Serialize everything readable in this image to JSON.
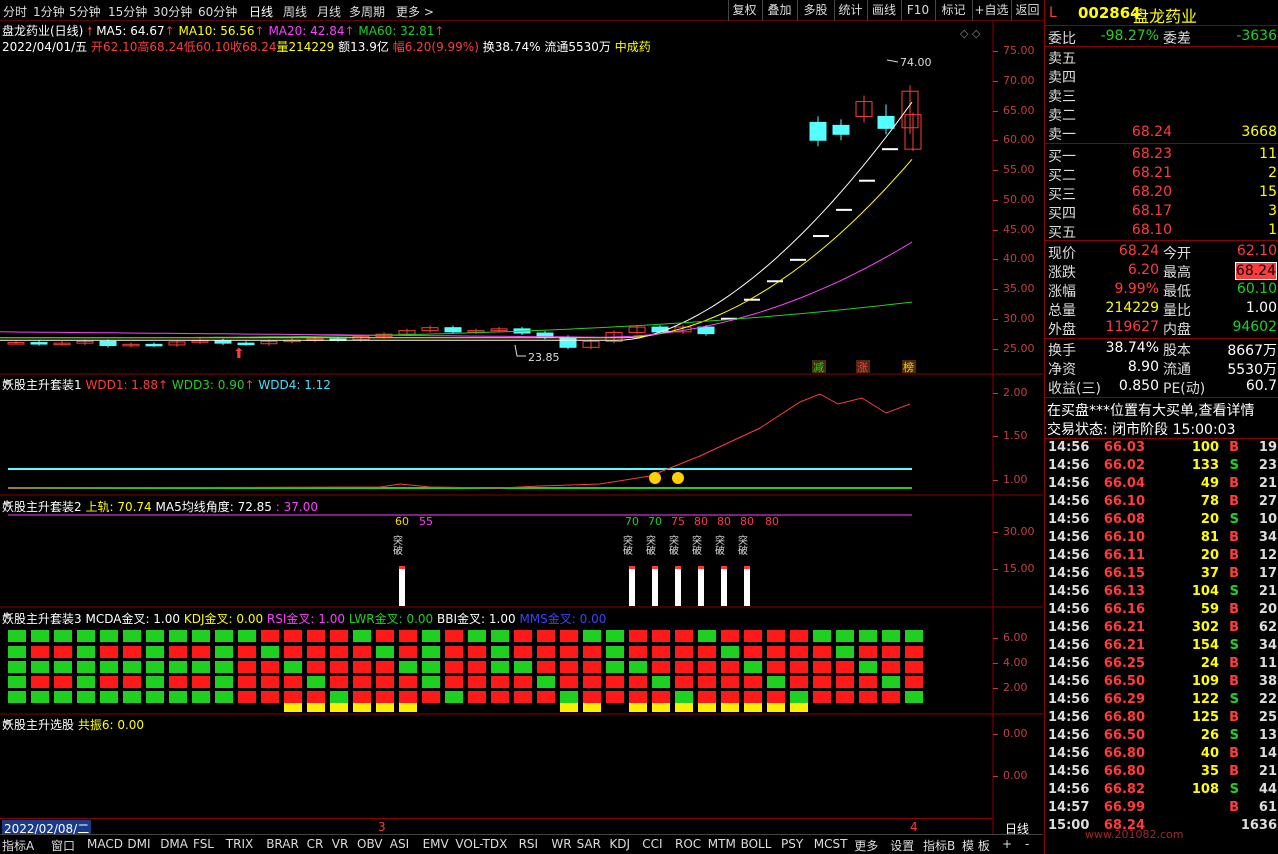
{
  "toolbar": {
    "periods": [
      "分时",
      "1分钟",
      "5分钟",
      "15分钟",
      "30分钟",
      "60分钟",
      "日线",
      "周线",
      "月线",
      "多周期",
      "更多 >"
    ],
    "buttons": [
      "复权",
      "叠加",
      "多股",
      "统计",
      "画线",
      "F10",
      "标记",
      "+自选",
      "返回"
    ]
  },
  "main_pane": {
    "title": "盘龙药业(日线)",
    "ma5": "MA5: 64.67",
    "ma10": "MA10: 56.56",
    "ma20": "MA20: 42.84",
    "ma60": "MA60: 32.81",
    "info_date": "2022/04/01/五",
    "open": "开62.10",
    "high": "高68.24",
    "low": "低60.10",
    "close": "收68.24",
    "vol": "量214229",
    "amount": "额13.9亿",
    "change": "幅6.20(9.99%)",
    "turnover": "换38.74%",
    "float": "流通5530万",
    "sector": "中成药",
    "high_mark": "74.00",
    "low_mark": "23.85",
    "y_ticks": [
      "75.00",
      "70.00",
      "65.00",
      "60.00",
      "55.00",
      "50.00",
      "45.00",
      "40.00",
      "35.00",
      "30.00",
      "25.00"
    ],
    "flags": [
      "减",
      "涨",
      "榜"
    ],
    "colors": {
      "ma5": "#ffffff",
      "ma10": "#ffff00",
      "ma20": "#ff40ff",
      "ma60": "#20d020",
      "up": "#ff3b3b",
      "down": "#54ffff"
    }
  },
  "pane2": {
    "title": "妖股主升套装1",
    "wdd1": "WDD1: 1.88",
    "wdd3": "WDD3: 0.90",
    "wdd4": "WDD4: 1.12",
    "y_ticks": [
      "2.00",
      "1.50",
      "1.00"
    ]
  },
  "pane3": {
    "title": "妖股主升套装2",
    "upper": "上轨: 70.74",
    "ma5angle": "MA5均线角度: 72.85",
    "val": ": 37.00",
    "y_ticks": [
      "30.00",
      "15.00"
    ],
    "labels": [
      "60",
      "55",
      "70",
      "70",
      "75",
      "80",
      "80",
      "80",
      "80"
    ],
    "break_text": "突破"
  },
  "pane4": {
    "title": "妖股主升套装3",
    "macd": "MCDA金叉: 1.00",
    "kdj": "KDJ金叉: 0.00",
    "rsi": "RSI金叉: 1.00",
    "lwr": "LWR金叉: 0.00",
    "bbi": "BBI金叉: 1.00",
    "mms": "MMS金叉: 0.00",
    "y_ticks": [
      "6.00",
      "4.00",
      "2.00"
    ]
  },
  "pane5": {
    "title": "妖股主升选股",
    "resonance": "共振6: 0.00",
    "y_ticks": [
      "0.00",
      "0.00"
    ]
  },
  "time_axis": {
    "date": "2022/02/08/二",
    "m3": "3",
    "m4": "4",
    "period": "日线"
  },
  "bottom_tabs": [
    "指标A",
    "窗口",
    "MACD",
    "DMI",
    "DMA",
    "FSL",
    "TRIX",
    "BRAR",
    "CR",
    "VR",
    "OBV",
    "ASI",
    "EMV",
    "VOL-TDX",
    "RSI",
    "WR",
    "SAR",
    "KDJ",
    "CCI",
    "ROC",
    "MTM",
    "BOLL",
    "PSY",
    "MCST",
    "更多",
    "设置"
  ],
  "bottom_right": [
    "指标B",
    "模 板",
    "+",
    "-"
  ],
  "quote": {
    "code": "002864",
    "name": "盘龙药业",
    "flag": "L",
    "weibi_label": "委比",
    "weibi": "-98.27%",
    "weicha_label": "委差",
    "weicha": "-3636",
    "sells": [
      {
        "l": "卖五",
        "p": "",
        "v": ""
      },
      {
        "l": "卖四",
        "p": "",
        "v": ""
      },
      {
        "l": "卖三",
        "p": "",
        "v": ""
      },
      {
        "l": "卖二",
        "p": "",
        "v": ""
      },
      {
        "l": "卖一",
        "p": "68.24",
        "v": "3668"
      }
    ],
    "buys": [
      {
        "l": "买一",
        "p": "68.23",
        "v": "11"
      },
      {
        "l": "买二",
        "p": "68.21",
        "v": "2"
      },
      {
        "l": "买三",
        "p": "68.20",
        "v": "15"
      },
      {
        "l": "买四",
        "p": "68.17",
        "v": "3"
      },
      {
        "l": "买五",
        "p": "68.10",
        "v": "1"
      }
    ],
    "stats": [
      {
        "l1": "现价",
        "v1": "68.24",
        "l2": "今开",
        "v2": "62.10"
      },
      {
        "l1": "涨跌",
        "v1": "6.20",
        "l2": "最高",
        "v2": "68.24"
      },
      {
        "l1": "涨幅",
        "v1": "9.99%",
        "l2": "最低",
        "v2": "60.10"
      },
      {
        "l1": "总量",
        "v1": "214229",
        "l2": "量比",
        "v2": "1.00"
      },
      {
        "l1": "外盘",
        "v1": "119627",
        "l2": "内盘",
        "v2": "94602"
      }
    ],
    "stats2": [
      {
        "l1": "换手",
        "v1": "38.74%",
        "l2": "股本",
        "v2": "8667万"
      },
      {
        "l1": "净资",
        "v1": "8.90",
        "l2": "流通",
        "v2": "5530万"
      },
      {
        "l1": "收益(三)",
        "v1": "0.850",
        "l2": "PE(动)",
        "v2": "60.7"
      }
    ],
    "notice": "在买盘***位置有大买单,查看详情",
    "status": "交易状态: 闭市阶段 15:00:03",
    "ticks": [
      [
        "14:56",
        "66.03",
        "100",
        "B",
        "19"
      ],
      [
        "14:56",
        "66.02",
        "133",
        "S",
        "23"
      ],
      [
        "14:56",
        "66.04",
        "49",
        "B",
        "21"
      ],
      [
        "14:56",
        "66.10",
        "78",
        "B",
        "27"
      ],
      [
        "14:56",
        "66.08",
        "20",
        "S",
        "10"
      ],
      [
        "14:56",
        "66.10",
        "81",
        "B",
        "34"
      ],
      [
        "14:56",
        "66.11",
        "20",
        "B",
        "12"
      ],
      [
        "14:56",
        "66.15",
        "37",
        "B",
        "17"
      ],
      [
        "14:56",
        "66.13",
        "104",
        "S",
        "21"
      ],
      [
        "14:56",
        "66.16",
        "59",
        "B",
        "20"
      ],
      [
        "14:56",
        "66.21",
        "302",
        "B",
        "62"
      ],
      [
        "14:56",
        "66.21",
        "154",
        "S",
        "34"
      ],
      [
        "14:56",
        "66.25",
        "24",
        "B",
        "11"
      ],
      [
        "14:56",
        "66.50",
        "109",
        "B",
        "38"
      ],
      [
        "14:56",
        "66.29",
        "122",
        "S",
        "22"
      ],
      [
        "14:56",
        "66.80",
        "125",
        "B",
        "25"
      ],
      [
        "14:56",
        "66.50",
        "26",
        "S",
        "13"
      ],
      [
        "14:56",
        "66.80",
        "40",
        "B",
        "14"
      ],
      [
        "14:56",
        "66.80",
        "35",
        "B",
        "21"
      ],
      [
        "14:56",
        "66.82",
        "108",
        "S",
        "44"
      ],
      [
        "14:57",
        "66.99",
        "",
        "B",
        "61"
      ],
      [
        "15:00",
        "68.24",
        "",
        "",
        "1636"
      ]
    ]
  },
  "watermark": "www.201082.com"
}
